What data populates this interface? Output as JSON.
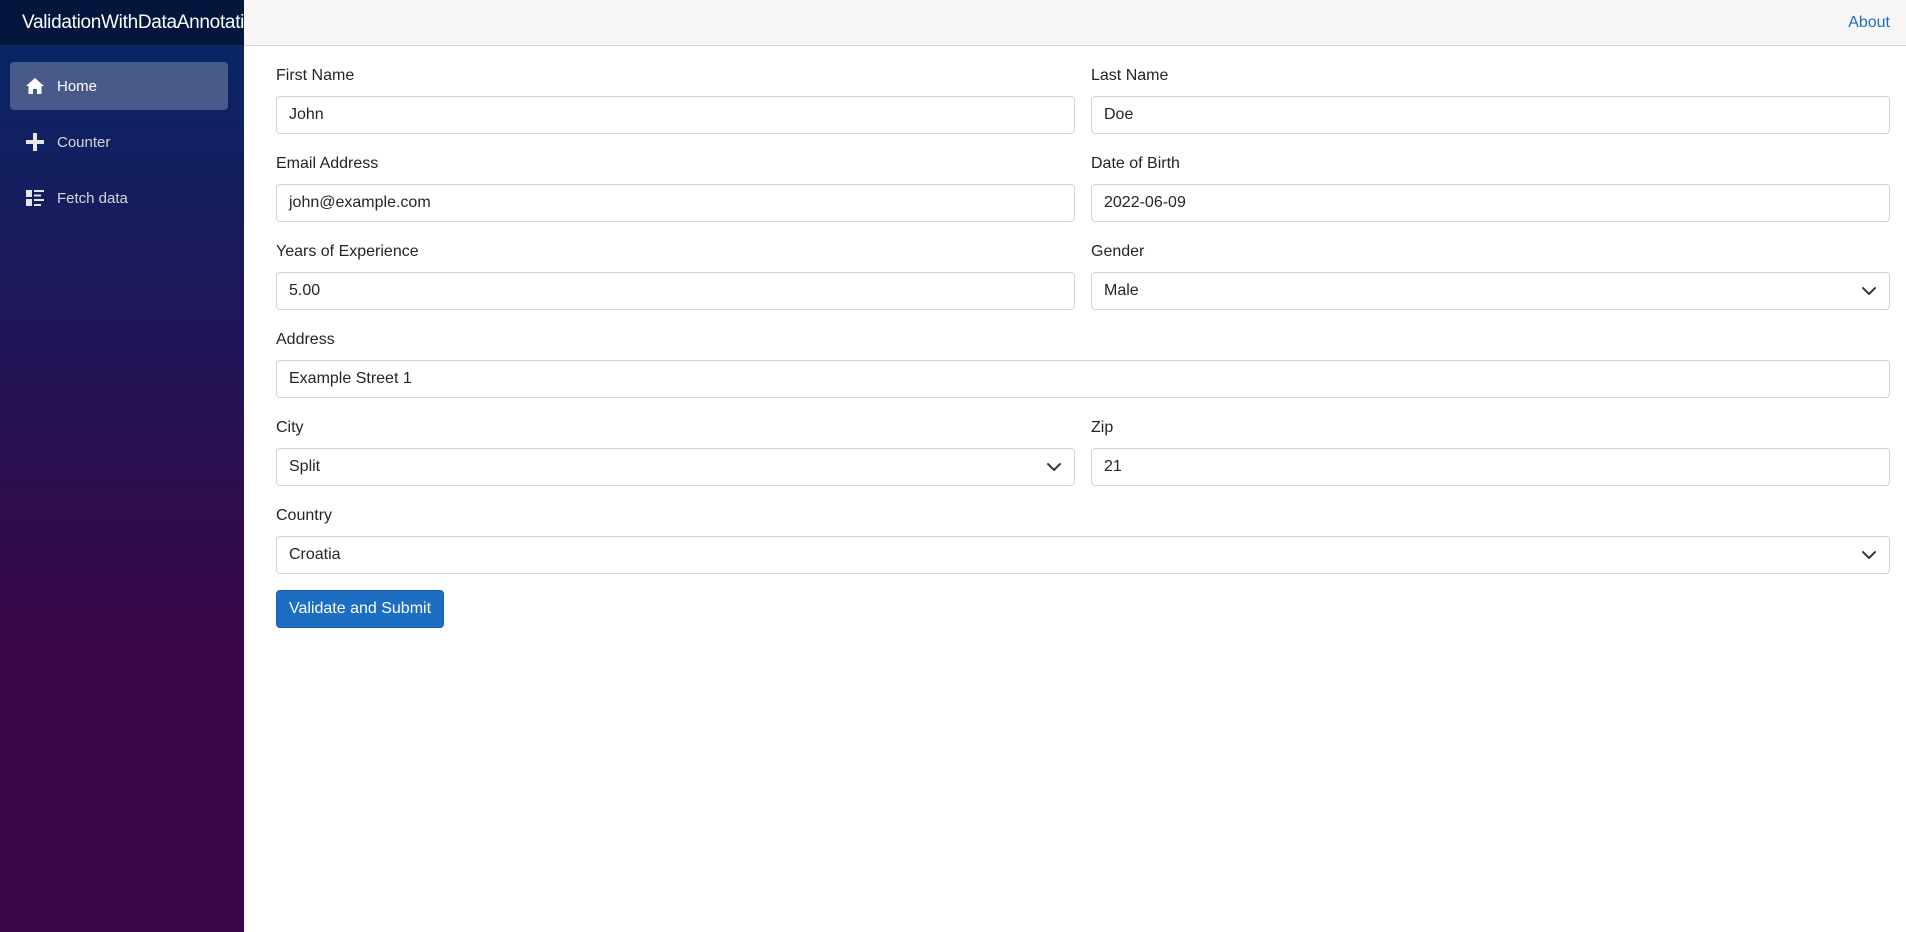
{
  "app": {
    "brand": "ValidationWithDataAnnotatio"
  },
  "sidebar": {
    "items": [
      {
        "label": "Home",
        "icon": "home-icon",
        "active": true
      },
      {
        "label": "Counter",
        "icon": "plus-icon",
        "active": false
      },
      {
        "label": "Fetch data",
        "icon": "list-icon",
        "active": false
      }
    ]
  },
  "topbar": {
    "about_label": "About"
  },
  "form": {
    "first_name": {
      "label": "First Name",
      "value": "John"
    },
    "last_name": {
      "label": "Last Name",
      "value": "Doe"
    },
    "email": {
      "label": "Email Address",
      "value": "john@example.com"
    },
    "dob": {
      "label": "Date of Birth",
      "value": "2022-06-09"
    },
    "experience": {
      "label": "Years of Experience",
      "value": "5.00"
    },
    "gender": {
      "label": "Gender",
      "value": "Male"
    },
    "address": {
      "label": "Address",
      "value": "Example Street 1"
    },
    "city": {
      "label": "City",
      "value": "Split"
    },
    "zip": {
      "label": "Zip",
      "value": "21"
    },
    "country": {
      "label": "Country",
      "value": "Croatia"
    },
    "submit_label": "Validate and Submit"
  },
  "colors": {
    "accent": "#1b6ec2",
    "sidebar_top": "#052767",
    "sidebar_bottom": "#3a0647"
  }
}
